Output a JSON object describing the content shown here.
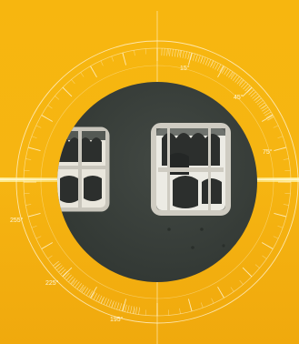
{
  "dial": {
    "labels": {
      "d15": "15°",
      "d45": "45°",
      "d75": "75°",
      "d255": "255°",
      "d225": "225°",
      "d195": "195°"
    },
    "background_color": "#f5b514",
    "line_color": "#fff3cf",
    "glow_color": "#fff7a8"
  },
  "scene": {
    "panel_color": "#3a403c",
    "window_frame_color": "#c9c6bc"
  }
}
